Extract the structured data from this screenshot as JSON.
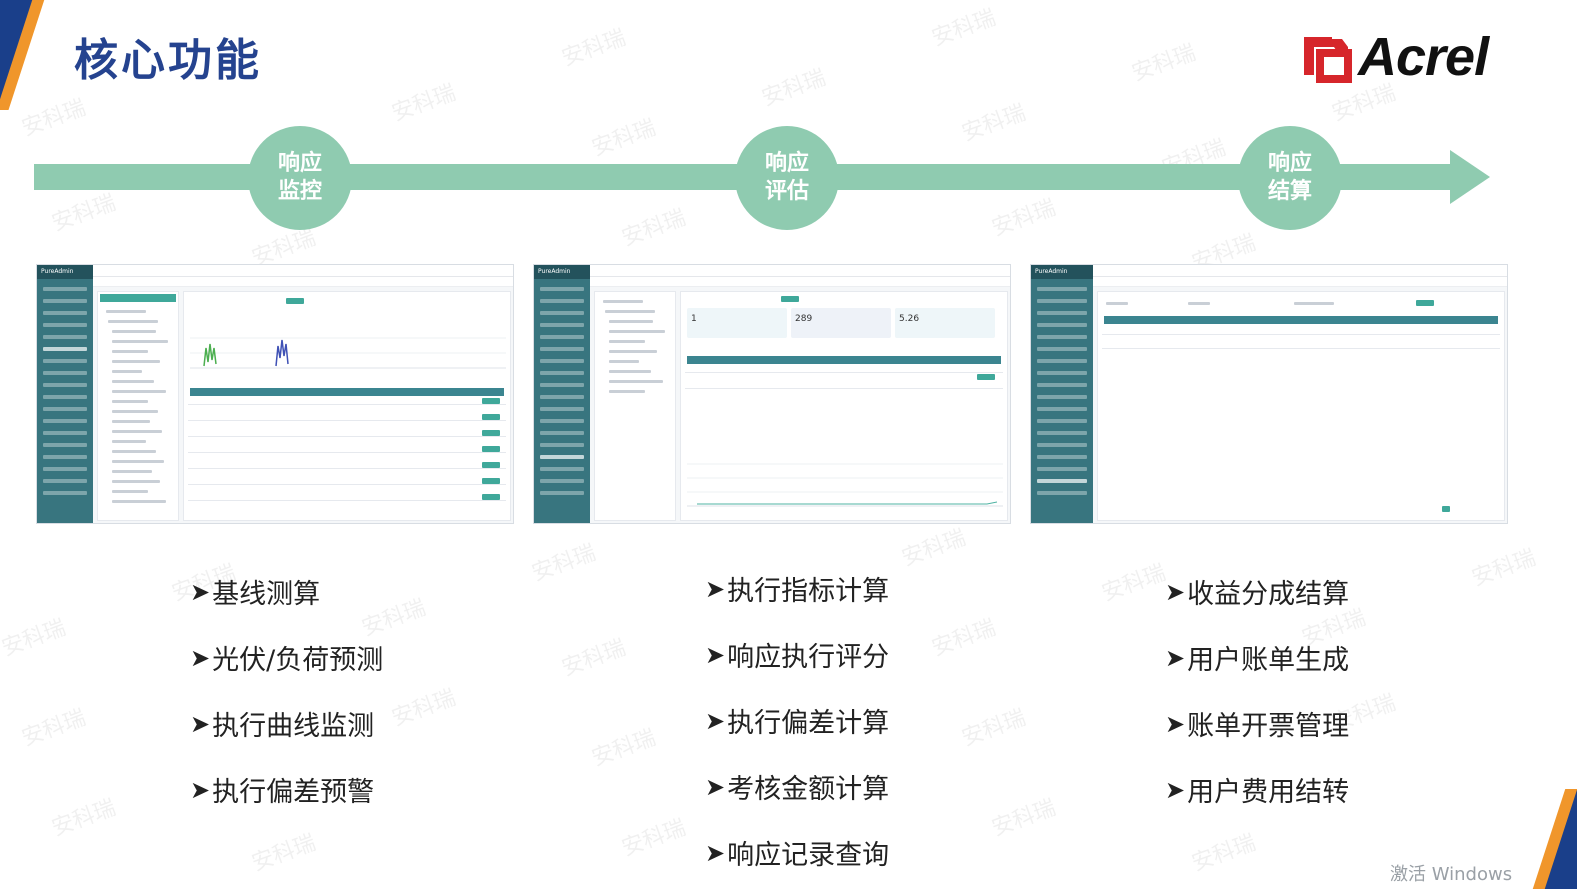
{
  "page_title": "核心功能",
  "logo_text": "Acrel",
  "watermark_text": "安科瑞",
  "brand_colors": {
    "title": "#25438f",
    "accent_orange": "#f0962b",
    "timeline": "#8fcbb0",
    "logo_red": "#d6262b"
  },
  "stages": [
    {
      "line1": "响应",
      "line2": "监控"
    },
    {
      "line1": "响应",
      "line2": "评估"
    },
    {
      "line1": "响应",
      "line2": "结算"
    }
  ],
  "screenshots": [
    {
      "app_brand": "PureAdmin",
      "name": "monitoring-screenshot"
    },
    {
      "app_brand": "PureAdmin",
      "name": "evaluation-screenshot",
      "metrics": [
        "1",
        "289",
        "5.26"
      ]
    },
    {
      "app_brand": "PureAdmin",
      "name": "settlement-screenshot"
    }
  ],
  "feature_columns": [
    {
      "items": [
        "基线测算",
        "光伏/负荷预测",
        "执行曲线监测",
        "执行偏差预警"
      ]
    },
    {
      "items": [
        "执行指标计算",
        "响应执行评分",
        "执行偏差计算",
        "考核金额计算",
        "响应记录查询"
      ]
    },
    {
      "items": [
        "收益分成结算",
        "用户账单生成",
        "账单开票管理",
        "用户费用结转"
      ]
    }
  ],
  "bullet_icon": "arrow-bullet-icon",
  "system_notice": "激活 Windows"
}
